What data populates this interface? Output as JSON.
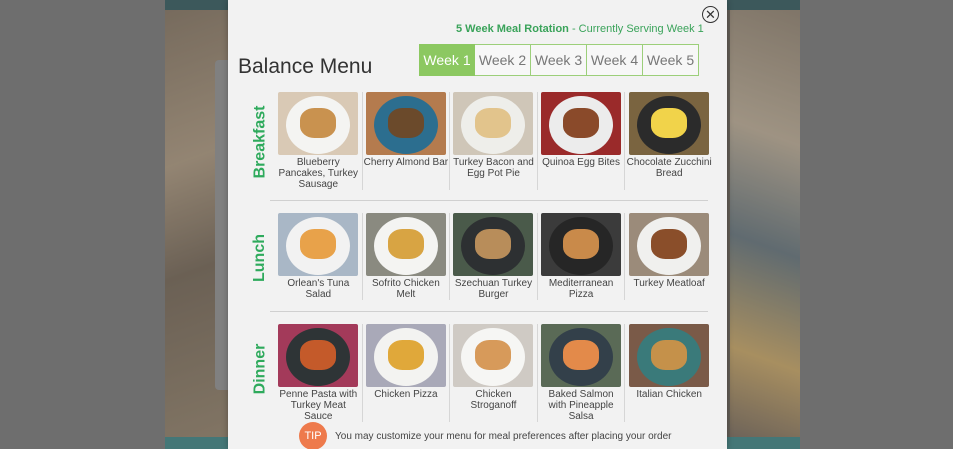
{
  "header": {
    "rotation_title": "5 Week Meal Rotation",
    "rotation_status": " - Currently Serving Week 1",
    "page_title": "Balance Menu",
    "close_glyph": "✕"
  },
  "weeks": [
    {
      "label": "Week 1",
      "active": true
    },
    {
      "label": "Week 2",
      "active": false
    },
    {
      "label": "Week 3",
      "active": false
    },
    {
      "label": "Week 4",
      "active": false
    },
    {
      "label": "Week 5",
      "active": false
    }
  ],
  "meals": [
    {
      "label": "Breakfast",
      "items": [
        {
          "name": "Blueberry Pancakes, Turkey Sausage",
          "bg": "#d9c9b5",
          "plate": "#f4f4f2",
          "food": "#c9924f"
        },
        {
          "name": "Cherry Almond Bar",
          "bg": "#b47b4e",
          "plate": "#2c6e8f",
          "food": "#6b4a2b"
        },
        {
          "name": "Turkey Bacon and Egg Pot Pie",
          "bg": "#cfc6b8",
          "plate": "#eeeeea",
          "food": "#e2c48c"
        },
        {
          "name": "Quinoa Egg Bites",
          "bg": "#9a2a2a",
          "plate": "#ececec",
          "food": "#8a4a2a"
        },
        {
          "name": "Chocolate Zucchini Bread",
          "bg": "#7a6440",
          "plate": "#2b2b2b",
          "food": "#f1d34a"
        }
      ]
    },
    {
      "label": "Lunch",
      "items": [
        {
          "name": "Orlean's Tuna Salad",
          "bg": "#a9b7c6",
          "plate": "#f2f2f2",
          "food": "#e8a24a"
        },
        {
          "name": "Sofrito Chicken Melt",
          "bg": "#8a8a80",
          "plate": "#f4f4f2",
          "food": "#d8a443"
        },
        {
          "name": "Szechuan Turkey Burger",
          "bg": "#4a5a4a",
          "plate": "#2d3032",
          "food": "#b88d5a"
        },
        {
          "name": "Mediterranean Pizza",
          "bg": "#3b3b3b",
          "plate": "#262626",
          "food": "#c98a4a"
        },
        {
          "name": "Turkey Meatloaf",
          "bg": "#9b8b7a",
          "plate": "#f0f0ee",
          "food": "#8a4e2a"
        }
      ]
    },
    {
      "label": "Dinner",
      "items": [
        {
          "name": "Penne Pasta with Turkey Meat Sauce",
          "bg": "#a33a5a",
          "plate": "#2e3436",
          "food": "#c45a2a"
        },
        {
          "name": "Chicken Pizza",
          "bg": "#a9a9b8",
          "plate": "#f3f3f1",
          "food": "#e0a83a"
        },
        {
          "name": "Chicken Stroganoff",
          "bg": "#cfcac4",
          "plate": "#f6f6f4",
          "food": "#d79a5a"
        },
        {
          "name": "Baked Salmon with Pineapple Salsa",
          "bg": "#5a6a56",
          "plate": "#33404a",
          "food": "#e38a4a"
        },
        {
          "name": "Italian Chicken",
          "bg": "#7a5a48",
          "plate": "#3a7a7a",
          "food": "#c5914a"
        }
      ]
    }
  ],
  "tip": {
    "badge": "TIP",
    "text": "You may customize your menu for meal preferences after placing your order"
  },
  "colors": {
    "accent_green": "#2eaa5c",
    "active_tab": "#8cc861",
    "tip_badge": "#ee7a4c"
  }
}
